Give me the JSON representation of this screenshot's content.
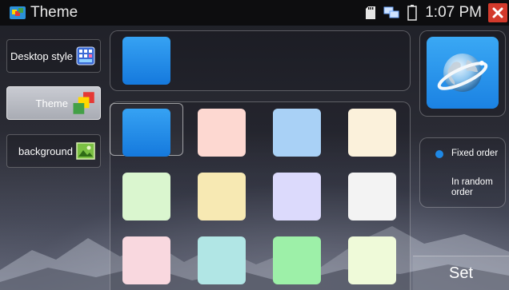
{
  "app": {
    "title": "Theme",
    "clock": "1:07 PM"
  },
  "tabs": [
    {
      "label": "Desktop style",
      "icon": "desktop-style-icon",
      "active": false
    },
    {
      "label": "Theme",
      "icon": "theme-icon",
      "active": true
    },
    {
      "label": "background",
      "icon": "background-image-icon",
      "active": false
    }
  ],
  "preview": {
    "color": "#1c8ae8"
  },
  "swatches": [
    "#1c8ae8",
    "#fdd8d1",
    "#a9d1f6",
    "#fbf1db",
    "#daf6cf",
    "#f7e9b3",
    "#dcdafc",
    "#f3f3f3",
    "#f9d8df",
    "#b1e6e5",
    "#9df0a8",
    "#effad9"
  ],
  "order": {
    "options": [
      {
        "label": "Fixed order",
        "selected": true
      },
      {
        "label": "In random order",
        "selected": false
      }
    ],
    "accent": "#1e88e5"
  },
  "set_label": "Set"
}
